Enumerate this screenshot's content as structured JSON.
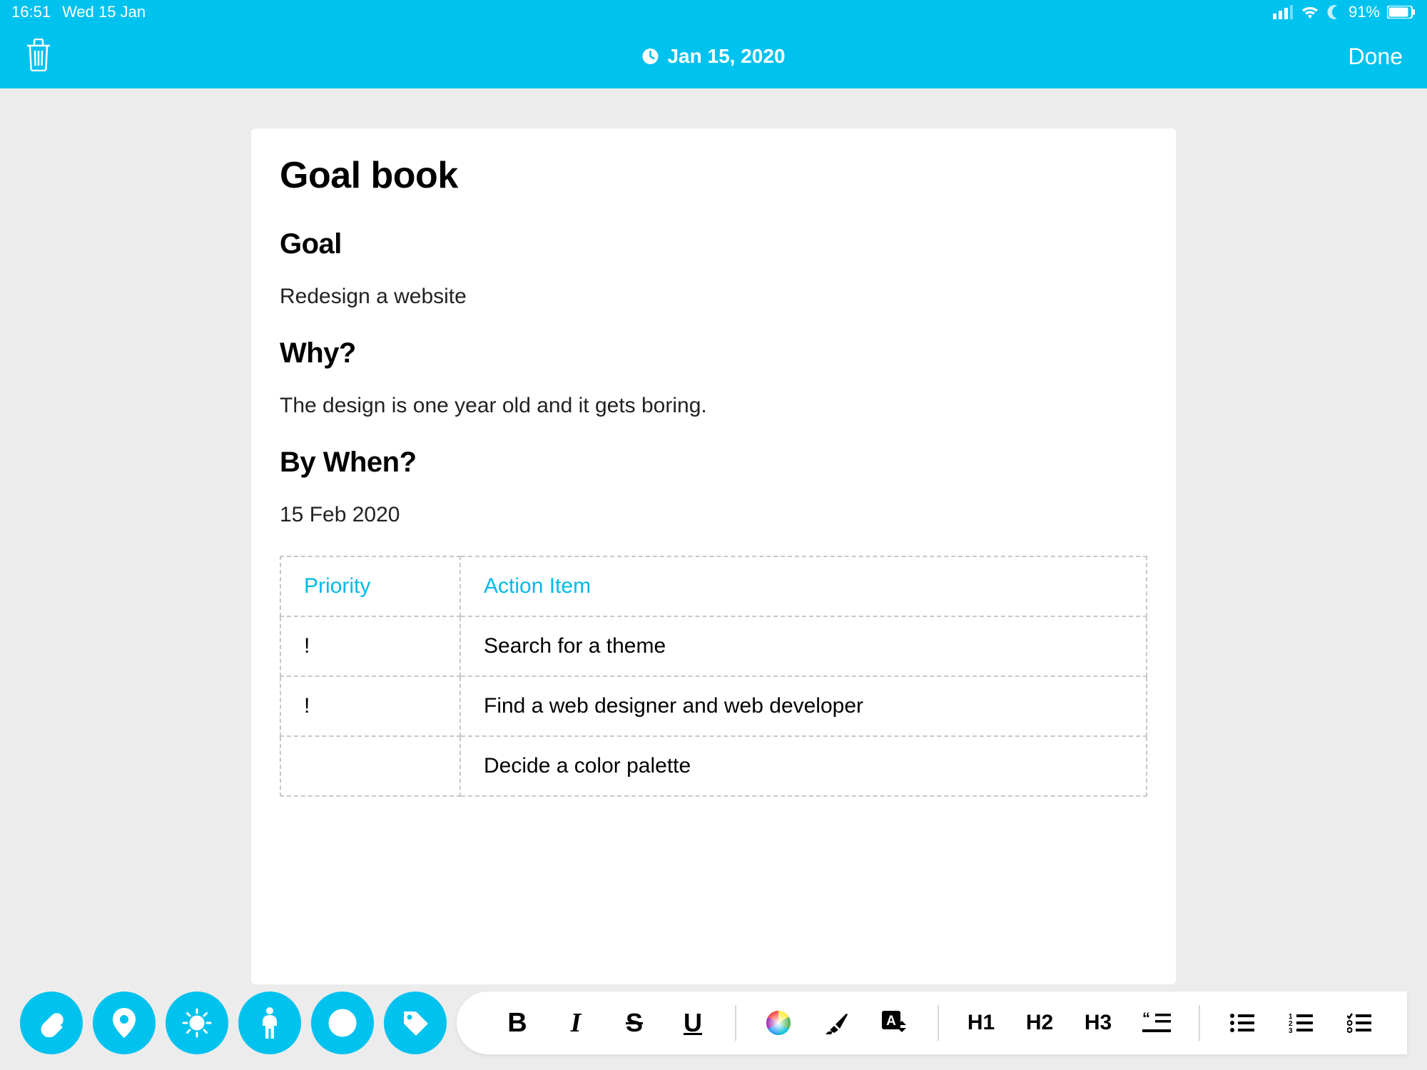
{
  "statusbar": {
    "time": "16:51",
    "date": "Wed 15 Jan",
    "battery": "91%"
  },
  "navbar": {
    "date": "Jan 15, 2020",
    "done": "Done"
  },
  "document": {
    "title": "Goal book",
    "sections": [
      {
        "heading": "Goal",
        "body": "Redesign a website"
      },
      {
        "heading": "Why?",
        "body": "The design is one year old and it gets boring."
      },
      {
        "heading": "By When?",
        "body": "15 Feb 2020"
      }
    ],
    "table": {
      "headers": [
        "Priority",
        "Action Item"
      ],
      "rows": [
        [
          "!",
          "Search for a theme"
        ],
        [
          "!",
          "Find a web designer and web developer"
        ],
        [
          "",
          "Decide a color palette"
        ]
      ]
    }
  },
  "toolbar": {
    "circle_icons": [
      "attachment",
      "location",
      "weather",
      "person",
      "mood",
      "tag"
    ],
    "format": {
      "bold": "B",
      "italic": "I",
      "strike": "S",
      "underline": "U",
      "h1": "H1",
      "h2": "H2",
      "h3": "H3"
    }
  },
  "colors": {
    "accent": "#00c2ee",
    "link": "#00b9e7"
  }
}
